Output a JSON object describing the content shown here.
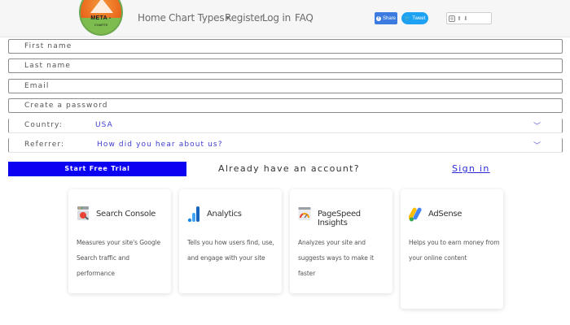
{
  "nav": {
    "logo_text": "META -",
    "logo_sub": "CHARTS",
    "links": [
      "Home",
      "Chart Types",
      "Register",
      "Log in",
      "FAQ"
    ],
    "share_label": "Share",
    "tweet_label": "Tweet"
  },
  "form": {
    "first_name_placeholder": "First name",
    "last_name_placeholder": "Last name",
    "email_placeholder": "Email",
    "password_placeholder": "Create a password",
    "country_label": "Country:",
    "country_value": "USA",
    "referrer_label": "Referrer:",
    "referrer_value": "How did you hear about us?",
    "cta_label": "Start Free Trial",
    "already_text": "Already have an account?",
    "signin_label": "Sign in"
  },
  "cards": [
    {
      "title": "Search Console",
      "desc": "Measures your site's Google Search traffic and performance",
      "icon": "search-console-icon"
    },
    {
      "title": "Analytics",
      "desc": "Tells you how users find, use, and engage with your site",
      "icon": "analytics-icon"
    },
    {
      "title": "PageSpeed Insights",
      "desc": "Analyzes your site and suggests ways to make it faster",
      "icon": "pagespeed-icon"
    },
    {
      "title": "AdSense",
      "desc": "Helps you to earn money from your online content",
      "icon": "adsense-icon"
    }
  ],
  "colors": {
    "cta_bg": "#0b00f2",
    "link": "#2a2ad8",
    "share_bg": "#3b7be0",
    "tweet_bg": "#1da1f2"
  }
}
